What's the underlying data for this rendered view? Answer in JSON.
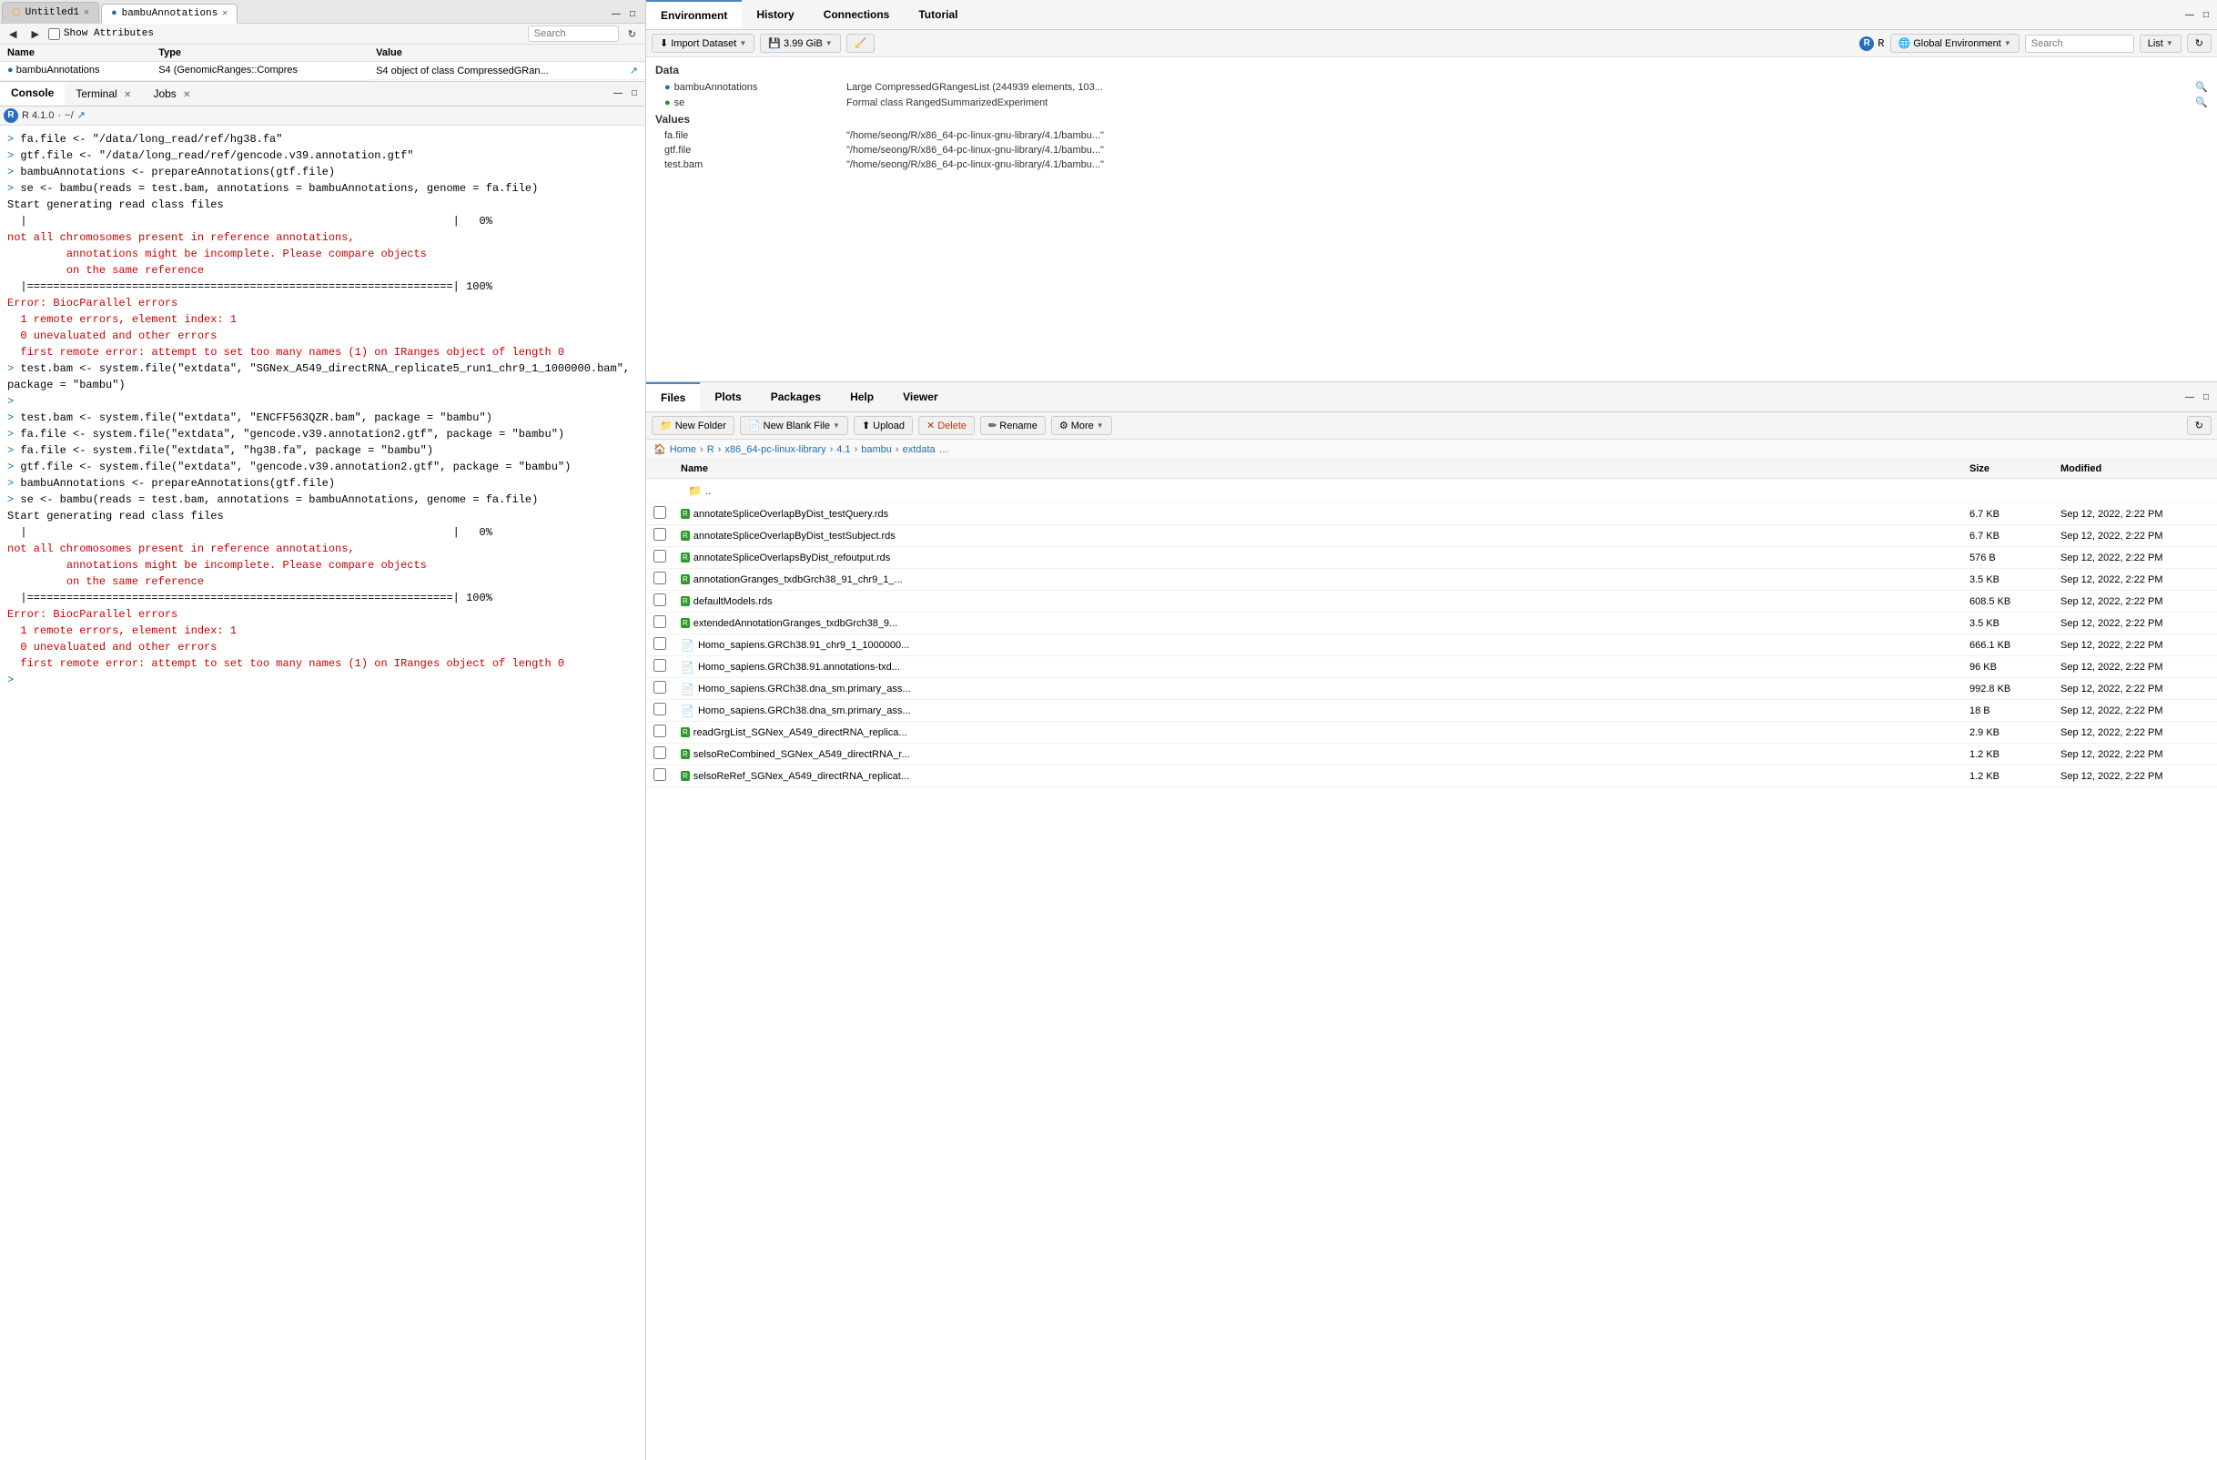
{
  "left": {
    "tabs": [
      {
        "label": "Untitled1",
        "active": false,
        "closable": true
      },
      {
        "label": "bambuAnnotations",
        "active": true,
        "closable": true
      }
    ],
    "var_toolbar": {
      "back_btn": "◀",
      "forward_btn": "▶",
      "show_attrs_label": "Show Attributes",
      "refresh_btn": "↻"
    },
    "var_table": {
      "headers": [
        "Name",
        "Type",
        "Value"
      ],
      "rows": [
        {
          "name": "bambuAnnotations",
          "type": "S4 (GenomicRanges::Compres",
          "value": "S4 object of class CompressedGRan...",
          "icon": "blue"
        }
      ]
    },
    "console": {
      "tabs": [
        {
          "label": "Console",
          "active": true,
          "closable": false
        },
        {
          "label": "Terminal",
          "active": false,
          "closable": true
        },
        {
          "label": "Jobs",
          "active": false,
          "closable": true
        }
      ],
      "r_version": "R 4.1.0",
      "working_dir": "~/",
      "lines": [
        {
          "type": "cmd",
          "text": "> fa.file <- \"/data/long_read/ref/hg38.fa\""
        },
        {
          "type": "cmd",
          "text": "> gtf.file <- \"/data/long_read/ref/gencode.v39.annotation.gtf\""
        },
        {
          "type": "cmd",
          "text": "> bambuAnnotations <- prepareAnnotations(gtf.file)"
        },
        {
          "type": "cmd",
          "text": "> se <- bambu(reads = test.bam, annotations = bambuAnnotations, genome = fa.file)"
        },
        {
          "type": "output",
          "text": "Start generating read class files"
        },
        {
          "type": "progress",
          "text": "  |                                                                 |   0%"
        },
        {
          "type": "error",
          "text": "not all chromosomes present in reference annotations,"
        },
        {
          "type": "error",
          "text": "         annotations might be incomplete. Please compare objects"
        },
        {
          "type": "error",
          "text": "         on the same reference"
        },
        {
          "type": "progress",
          "text": "  |=================================================================| 100%"
        },
        {
          "type": "error",
          "text": ""
        },
        {
          "type": "error",
          "text": "Error: BiocParallel errors"
        },
        {
          "type": "error",
          "text": "  1 remote errors, element index: 1"
        },
        {
          "type": "error",
          "text": "  0 unevaluated and other errors"
        },
        {
          "type": "error",
          "text": "  first remote error: attempt to set too many names (1) on IRanges object of length 0"
        },
        {
          "type": "cmd",
          "text": "> test.bam <- system.file(\"extdata\", \"SGNex_A549_directRNA_replicate5_run1_chr9_1_1000000.bam\", package = \"bambu\")"
        },
        {
          "type": "cmd",
          "text": ">"
        },
        {
          "type": "cmd",
          "text": "> test.bam <- system.file(\"extdata\", \"ENCFF563QZR.bam\", package = \"bambu\")"
        },
        {
          "type": "cmd",
          "text": "> fa.file <- system.file(\"extdata\", \"gencode.v39.annotation2.gtf\", package = \"bambu\")"
        },
        {
          "type": "cmd",
          "text": "> fa.file <- system.file(\"extdata\", \"hg38.fa\", package = \"bambu\")"
        },
        {
          "type": "cmd",
          "text": "> gtf.file <- system.file(\"extdata\", \"gencode.v39.annotation2.gtf\", package = \"bambu\")"
        },
        {
          "type": "cmd",
          "text": "> bambuAnnotations <- prepareAnnotations(gtf.file)"
        },
        {
          "type": "cmd",
          "text": "> se <- bambu(reads = test.bam, annotations = bambuAnnotations, genome = fa.file)"
        },
        {
          "type": "output",
          "text": "Start generating read class files"
        },
        {
          "type": "progress",
          "text": "  |                                                                 |   0%"
        },
        {
          "type": "error",
          "text": "not all chromosomes present in reference annotations,"
        },
        {
          "type": "error",
          "text": "         annotations might be incomplete. Please compare objects"
        },
        {
          "type": "error",
          "text": "         on the same reference"
        },
        {
          "type": "progress",
          "text": "  |=================================================================| 100%"
        },
        {
          "type": "error",
          "text": ""
        },
        {
          "type": "error",
          "text": "Error: BiocParallel errors"
        },
        {
          "type": "error",
          "text": "  1 remote errors, element index: 1"
        },
        {
          "type": "error",
          "text": "  0 unevaluated and other errors"
        },
        {
          "type": "error",
          "text": "  first remote error: attempt to set too many names (1) on IRanges object of length 0"
        },
        {
          "type": "cmd",
          "text": "> "
        }
      ]
    }
  },
  "right": {
    "env": {
      "tabs": [
        {
          "label": "Environment",
          "active": true
        },
        {
          "label": "History",
          "active": false
        },
        {
          "label": "Connections",
          "active": false
        },
        {
          "label": "Tutorial",
          "active": false
        }
      ],
      "toolbar": {
        "import_btn": "Import Dataset",
        "memory_btn": "3.99 GiB",
        "broom_btn": "🧹",
        "list_btn": "List",
        "refresh_btn": "↻"
      },
      "selector": {
        "r_label": "R",
        "env_label": "Global Environment"
      },
      "data_section": "Data",
      "data_rows": [
        {
          "name": "bambuAnnotations",
          "value": "Large CompressedGRangesList (244939 elements,  103...",
          "icon": "blue",
          "search": true
        },
        {
          "name": "se",
          "value": "Formal class  RangedSummarizedExperiment",
          "icon": "green",
          "search": true
        }
      ],
      "values_section": "Values",
      "values_rows": [
        {
          "name": "fa.file",
          "value": "\"/home/seong/R/x86_64-pc-linux-gnu-library/4.1/bambu...\""
        },
        {
          "name": "gtf.file",
          "value": "\"/home/seong/R/x86_64-pc-linux-gnu-library/4.1/bambu...\""
        },
        {
          "name": "test.bam",
          "value": "\"/home/seong/R/x86_64-pc-linux-gnu-library/4.1/bambu...\""
        }
      ]
    },
    "files": {
      "tabs": [
        {
          "label": "Files",
          "active": true
        },
        {
          "label": "Plots",
          "active": false
        },
        {
          "label": "Packages",
          "active": false
        },
        {
          "label": "Help",
          "active": false
        },
        {
          "label": "Viewer",
          "active": false
        }
      ],
      "toolbar": {
        "new_folder_btn": "New Folder",
        "new_blank_file_btn": "New Blank File",
        "upload_btn": "Upload",
        "delete_btn": "Delete",
        "rename_btn": "Rename",
        "more_btn": "More"
      },
      "breadcrumb": [
        {
          "label": "Home",
          "icon": "🏠"
        },
        {
          "label": "R"
        },
        {
          "label": "x86_64-pc-linux-library"
        },
        {
          "label": "4.1"
        },
        {
          "label": "bambu"
        },
        {
          "label": "extdata"
        }
      ],
      "table_headers": [
        "Name",
        "Size",
        "Modified"
      ],
      "up_dir": "..",
      "files": [
        {
          "name": "annotateSpliceOverlapByDist_testQuery.rds",
          "size": "6.7 KB",
          "modified": "Sep 12, 2022, 2:22 PM",
          "type": "rds"
        },
        {
          "name": "annotateSpliceOverlapByDist_testSubject.rds",
          "size": "6.7 KB",
          "modified": "Sep 12, 2022, 2:22 PM",
          "type": "rds"
        },
        {
          "name": "annotateSpliceOverlapsByDist_refoutput.rds",
          "size": "576 B",
          "modified": "Sep 12, 2022, 2:22 PM",
          "type": "rds"
        },
        {
          "name": "annotationGranges_txdbGrch38_91_chr9_1_...",
          "size": "3.5 KB",
          "modified": "Sep 12, 2022, 2:22 PM",
          "type": "rds"
        },
        {
          "name": "defaultModels.rds",
          "size": "608.5 KB",
          "modified": "Sep 12, 2022, 2:22 PM",
          "type": "rds"
        },
        {
          "name": "extendedAnnotationGranges_txdbGrch38_9...",
          "size": "3.5 KB",
          "modified": "Sep 12, 2022, 2:22 PM",
          "type": "rds"
        },
        {
          "name": "Homo_sapiens.GRCh38.91_chr9_1_1000000...",
          "size": "666.1 KB",
          "modified": "Sep 12, 2022, 2:22 PM",
          "type": "generic"
        },
        {
          "name": "Homo_sapiens.GRCh38.91.annotations-txd...",
          "size": "96 KB",
          "modified": "Sep 12, 2022, 2:22 PM",
          "type": "generic"
        },
        {
          "name": "Homo_sapiens.GRCh38.dna_sm.primary_ass...",
          "size": "992.8 KB",
          "modified": "Sep 12, 2022, 2:22 PM",
          "type": "generic"
        },
        {
          "name": "Homo_sapiens.GRCh38.dna_sm.primary_ass...",
          "size": "18 B",
          "modified": "Sep 12, 2022, 2:22 PM",
          "type": "generic"
        },
        {
          "name": "readGrgList_SGNex_A549_directRNA_replica...",
          "size": "2.9 KB",
          "modified": "Sep 12, 2022, 2:22 PM",
          "type": "rds"
        },
        {
          "name": "selsoReCombined_SGNex_A549_directRNA_r...",
          "size": "1.2 KB",
          "modified": "Sep 12, 2022, 2:22 PM",
          "type": "rds"
        },
        {
          "name": "selsoReRef_SGNex_A549_directRNA_replicat...",
          "size": "1.2 KB",
          "modified": "Sep 12, 2022, 2:22 PM",
          "type": "rds"
        }
      ]
    }
  }
}
